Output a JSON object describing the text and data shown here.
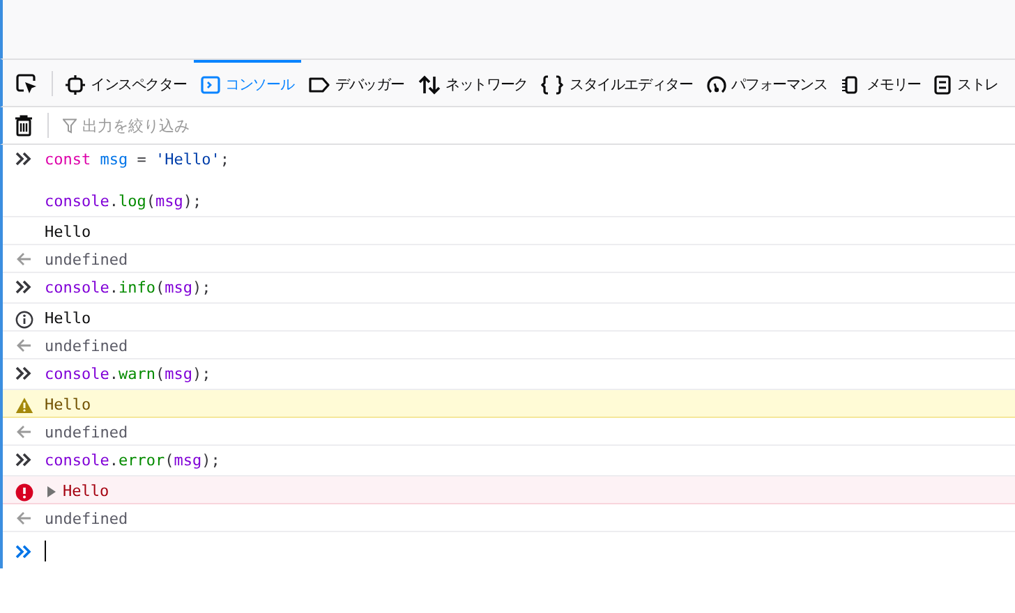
{
  "toolbar": {
    "tabs": [
      {
        "kind": "inspector",
        "label": "インスペクター",
        "selected": false
      },
      {
        "kind": "console",
        "label": "コンソール",
        "selected": true
      },
      {
        "kind": "debugger",
        "label": "デバッガー",
        "selected": false
      },
      {
        "kind": "network",
        "label": "ネットワーク",
        "selected": false
      },
      {
        "kind": "style",
        "label": "スタイルエディター",
        "selected": false
      },
      {
        "kind": "performance",
        "label": "パフォーマンス",
        "selected": false
      },
      {
        "kind": "memory",
        "label": "メモリー",
        "selected": false
      },
      {
        "kind": "storage",
        "label": "ストレ",
        "selected": false
      }
    ]
  },
  "filter": {
    "placeholder": "出力を絞り込み"
  },
  "entries": [
    {
      "kind": "input",
      "tokens": [
        {
          "kind": "keyword",
          "text": "const"
        },
        {
          "kind": "def",
          "text": " msg"
        },
        {
          "kind": "punct",
          "text": " = "
        },
        {
          "kind": "string",
          "text": "'Hello'"
        },
        {
          "kind": "punct",
          "text": ";\n\n"
        },
        {
          "kind": "variable",
          "text": "console"
        },
        {
          "kind": "punct",
          "text": "."
        },
        {
          "kind": "property",
          "text": "log"
        },
        {
          "kind": "punct",
          "text": "("
        },
        {
          "kind": "variable",
          "text": "msg"
        },
        {
          "kind": "punct",
          "text": ");"
        }
      ]
    },
    {
      "kind": "log",
      "text": "Hello"
    },
    {
      "kind": "result",
      "text": "undefined"
    },
    {
      "kind": "input",
      "tokens": [
        {
          "kind": "variable",
          "text": "console"
        },
        {
          "kind": "punct",
          "text": "."
        },
        {
          "kind": "property",
          "text": "info"
        },
        {
          "kind": "punct",
          "text": "("
        },
        {
          "kind": "variable",
          "text": "msg"
        },
        {
          "kind": "punct",
          "text": ");"
        }
      ]
    },
    {
      "kind": "info",
      "text": "Hello"
    },
    {
      "kind": "result",
      "text": "undefined"
    },
    {
      "kind": "input",
      "tokens": [
        {
          "kind": "variable",
          "text": "console"
        },
        {
          "kind": "punct",
          "text": "."
        },
        {
          "kind": "property",
          "text": "warn"
        },
        {
          "kind": "punct",
          "text": "("
        },
        {
          "kind": "variable",
          "text": "msg"
        },
        {
          "kind": "punct",
          "text": ");"
        }
      ]
    },
    {
      "kind": "warn",
      "text": "Hello"
    },
    {
      "kind": "result",
      "text": "undefined"
    },
    {
      "kind": "input",
      "tokens": [
        {
          "kind": "variable",
          "text": "console"
        },
        {
          "kind": "punct",
          "text": "."
        },
        {
          "kind": "property",
          "text": "error"
        },
        {
          "kind": "punct",
          "text": "("
        },
        {
          "kind": "variable",
          "text": "msg"
        },
        {
          "kind": "punct",
          "text": ");"
        }
      ]
    },
    {
      "kind": "error",
      "text": "Hello",
      "expanded": false
    },
    {
      "kind": "result",
      "text": "undefined"
    }
  ]
}
